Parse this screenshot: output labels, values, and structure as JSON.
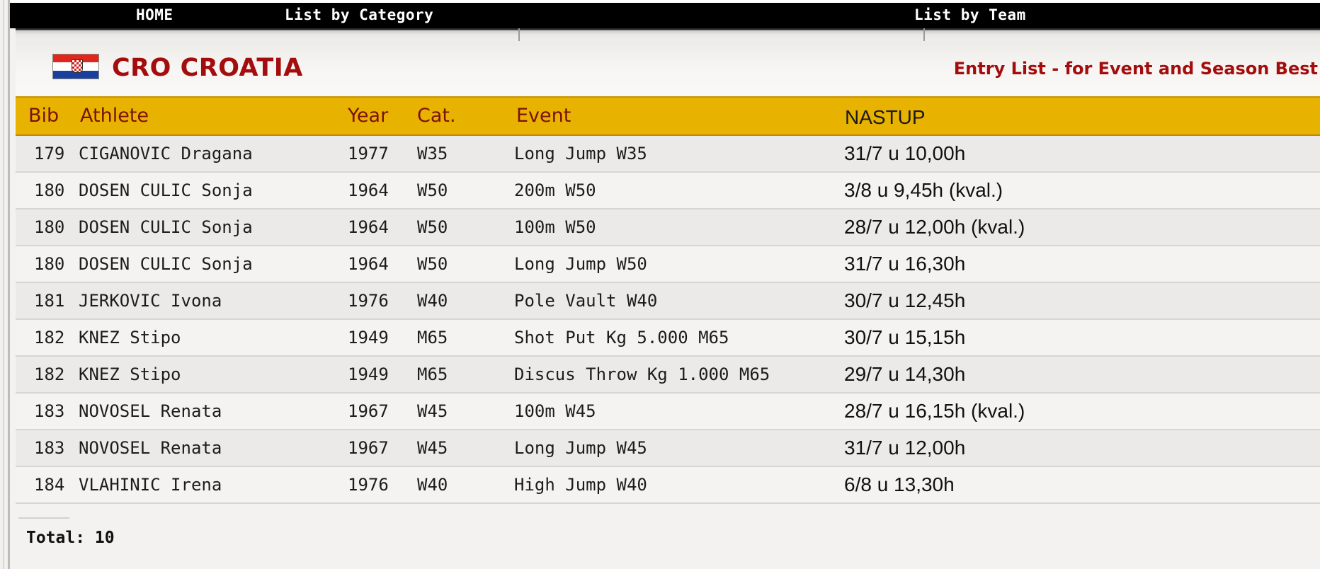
{
  "nav": {
    "home": "HOME",
    "by_category": "List by Category",
    "by_team": "List by Team"
  },
  "header": {
    "team": "CRO CROATIA",
    "subtitle": "Entry List - for Event and Season Best",
    "flag_icon": "croatia-flag-icon"
  },
  "colors": {
    "accent": "#e8b200",
    "title_red": "#a30d0d",
    "header_text": "#7a1208"
  },
  "table": {
    "columns": {
      "bib": "Bib",
      "athlete": "Athlete",
      "year": "Year",
      "cat": "Cat.",
      "event": "Event",
      "nastup": "NASTUP"
    },
    "rows": [
      {
        "bib": "179",
        "athlete": "CIGANOVIC Dragana",
        "year": "1977",
        "cat": "W35",
        "event": "Long Jump W35",
        "nastup": "31/7 u 10,00h"
      },
      {
        "bib": "180",
        "athlete": "DOSEN CULIC Sonja",
        "year": "1964",
        "cat": "W50",
        "event": "200m W50",
        "nastup": "3/8 u 9,45h (kval.)"
      },
      {
        "bib": "180",
        "athlete": "DOSEN CULIC Sonja",
        "year": "1964",
        "cat": "W50",
        "event": "100m W50",
        "nastup": "28/7 u 12,00h (kval.)"
      },
      {
        "bib": "180",
        "athlete": "DOSEN CULIC Sonja",
        "year": "1964",
        "cat": "W50",
        "event": "Long Jump W50",
        "nastup": "31/7 u 16,30h"
      },
      {
        "bib": "181",
        "athlete": "JERKOVIC Ivona",
        "year": "1976",
        "cat": "W40",
        "event": "Pole Vault W40",
        "nastup": "30/7 u 12,45h"
      },
      {
        "bib": "182",
        "athlete": "KNEZ Stipo",
        "year": "1949",
        "cat": "M65",
        "event": "Shot Put Kg 5.000 M65",
        "nastup": "30/7 u 15,15h"
      },
      {
        "bib": "182",
        "athlete": "KNEZ Stipo",
        "year": "1949",
        "cat": "M65",
        "event": "Discus Throw Kg 1.000 M65",
        "nastup": "29/7 u 14,30h"
      },
      {
        "bib": "183",
        "athlete": "NOVOSEL Renata",
        "year": "1967",
        "cat": "W45",
        "event": "100m W45",
        "nastup": "28/7 u 16,15h (kval.)"
      },
      {
        "bib": "183",
        "athlete": "NOVOSEL Renata",
        "year": "1967",
        "cat": "W45",
        "event": "Long Jump W45",
        "nastup": "31/7 u 12,00h"
      },
      {
        "bib": "184",
        "athlete": "VLAHINIC Irena",
        "year": "1976",
        "cat": "W40",
        "event": "High Jump W40",
        "nastup": "6/8 u 13,30h"
      }
    ]
  },
  "footer": {
    "total": "Total: 10"
  }
}
